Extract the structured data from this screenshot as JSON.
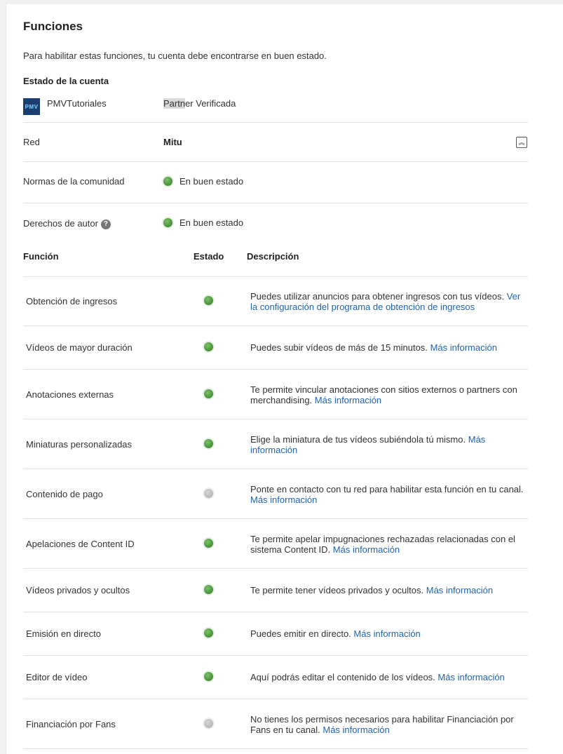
{
  "page": {
    "title": "Funciones",
    "intro": "Para habilitar estas funciones, tu cuenta debe encontrarse en buen estado.",
    "account_heading": "Estado de la cuenta"
  },
  "account": {
    "avatar_text": "PMV",
    "channel_name": "PMVTutoriales",
    "partner_prefix": "Partn",
    "partner_rest": "er Verificada",
    "network_label": "Red",
    "network_value": "Mitu",
    "community_label": "Normas de la comunidad",
    "community_status": "En buen estado",
    "copyright_label": "Derechos de autor",
    "copyright_status": "En buen estado",
    "status_color_good": "#4f9a3f"
  },
  "table": {
    "headers": [
      "Función",
      "Estado",
      "Descripción"
    ],
    "rows": [
      {
        "name": "Obtención de ingresos",
        "status": "enabled",
        "desc": "Puedes utilizar anuncios para obtener ingresos con tus vídeos.",
        "link": "Ver la configuración del programa de obtención de ingresos"
      },
      {
        "name": "Vídeos de mayor duración",
        "status": "enabled",
        "desc": "Puedes subir vídeos de más de 15 minutos.",
        "link": "Más información"
      },
      {
        "name": "Anotaciones externas",
        "status": "enabled",
        "desc": "Te permite vincular anotaciones con sitios externos o partners con merchandising.",
        "link": "Más información"
      },
      {
        "name": "Miniaturas personalizadas",
        "status": "enabled",
        "desc": "Elige la miniatura de tus vídeos subiéndola tú mismo.",
        "link": "Más información"
      },
      {
        "name": "Contenido de pago",
        "status": "disabled",
        "desc": "Ponte en contacto con tu red para habilitar esta función en tu canal.",
        "link": "Más información"
      },
      {
        "name": "Apelaciones de Content ID",
        "status": "enabled",
        "desc": "Te permite apelar impugnaciones rechazadas relacionadas con el sistema Content ID.",
        "link": "Más información"
      },
      {
        "name": "Vídeos privados y ocultos",
        "status": "enabled",
        "desc": "Te permite tener vídeos privados y ocultos.",
        "link": "Más información"
      },
      {
        "name": "Emisión en directo",
        "status": "enabled",
        "desc": "Puedes emitir en directo.",
        "link": "Más información"
      },
      {
        "name": "Editor de vídeo",
        "status": "enabled",
        "desc": "Aquí podrás editar el contenido de los vídeos.",
        "link": "Más información"
      },
      {
        "name": "Financiación por Fans",
        "status": "disabled",
        "desc": "No tienes los permisos necesarios para habilitar Financiación por Fans en tu canal.",
        "link": "Más información"
      }
    ]
  },
  "colors": {
    "link": "#1f63b5",
    "enabled_dot": "#4f9a3f",
    "disabled_dot": "#bdbdbd"
  }
}
